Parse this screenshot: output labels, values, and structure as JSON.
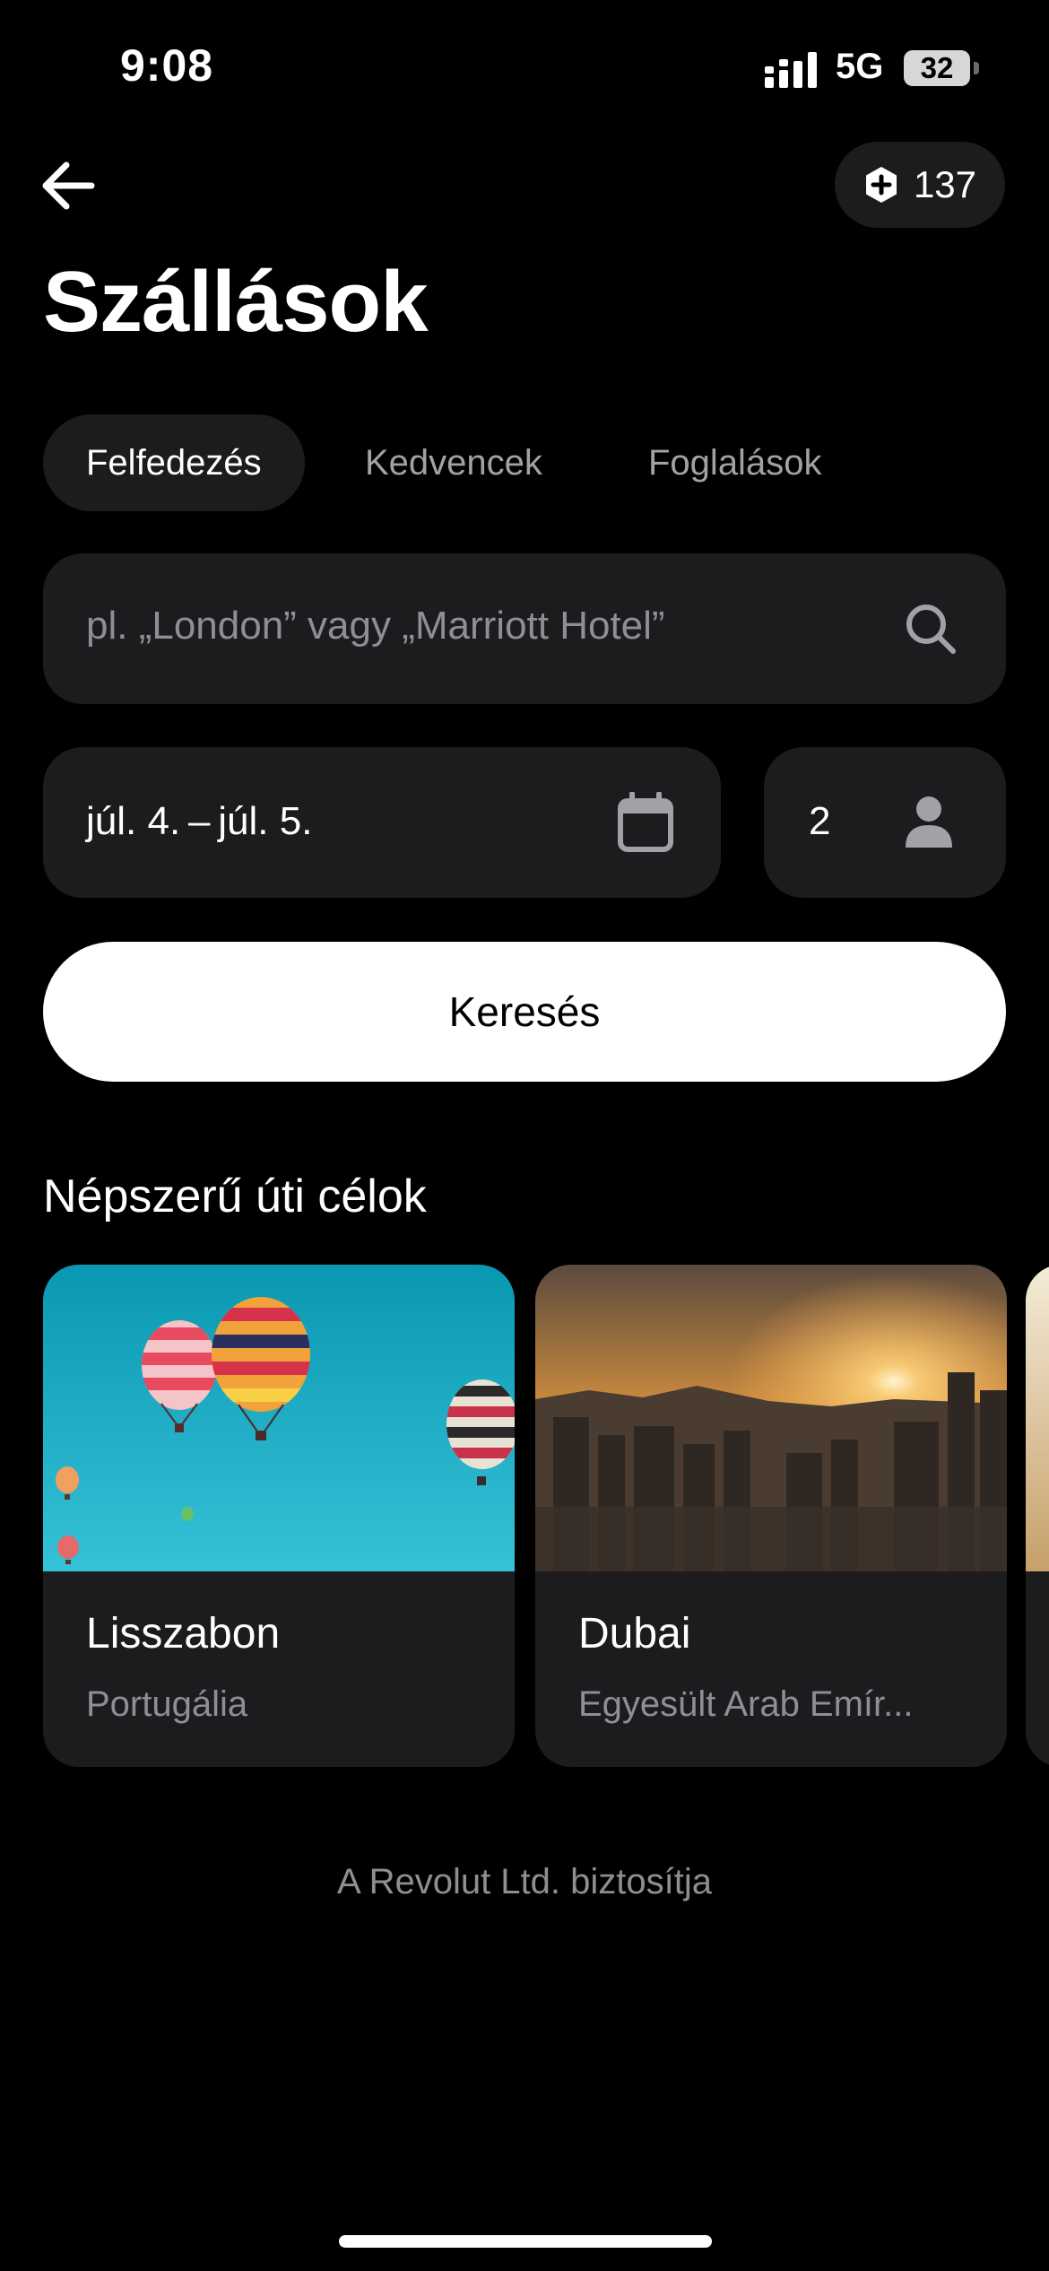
{
  "status_bar": {
    "time": "9:08",
    "network": "5G",
    "battery": "32"
  },
  "header": {
    "points": "137",
    "title": "Szállások"
  },
  "tabs": [
    {
      "label": "Felfedezés",
      "active": true
    },
    {
      "label": "Kedvencek",
      "active": false
    },
    {
      "label": "Foglalások",
      "active": false
    }
  ],
  "search": {
    "placeholder": "pl. „London” vagy „Marriott Hotel”"
  },
  "dates": {
    "value": "júl. 4. – júl. 5."
  },
  "guests": {
    "value": "2"
  },
  "search_button": {
    "label": "Keresés"
  },
  "popular": {
    "title": "Népszerű úti célok",
    "destinations": [
      {
        "name": "Lisszabon",
        "country": "Portugália"
      },
      {
        "name": "Dubai",
        "country": "Egyesült Arab Emír..."
      }
    ]
  },
  "footer": {
    "text": "A Revolut Ltd. biztosítja"
  },
  "colors": {
    "background": "#000000",
    "surface": "#1c1c1e",
    "muted": "#8e8e93",
    "accent": "#ffffff"
  }
}
